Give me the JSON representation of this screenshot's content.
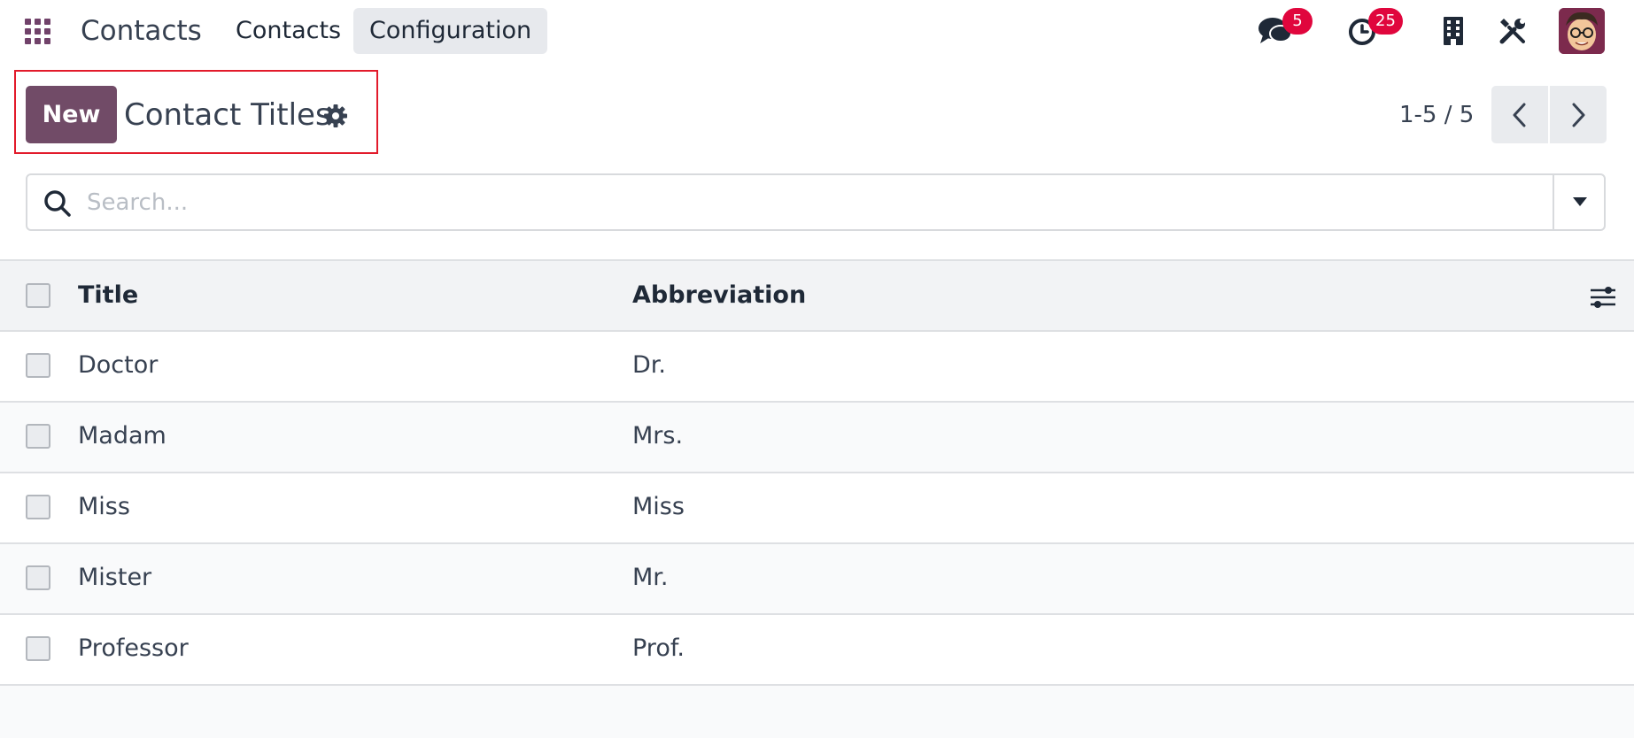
{
  "navbar": {
    "app_name": "Contacts",
    "menu": [
      {
        "label": "Contacts"
      },
      {
        "label": "Configuration",
        "active": true
      }
    ],
    "messages_badge": "5",
    "activities_badge": "25",
    "icons": [
      "apps-grid-icon",
      "chat-icon",
      "clock-icon",
      "building-icon",
      "tools-icon",
      "user-avatar"
    ]
  },
  "control_panel": {
    "new_label": "New",
    "title": "Contact Titles",
    "pager": "1-5 / 5"
  },
  "search": {
    "placeholder": "Search..."
  },
  "table": {
    "columns": [
      "Title",
      "Abbreviation"
    ],
    "rows": [
      {
        "title": "Doctor",
        "abbreviation": "Dr."
      },
      {
        "title": "Madam",
        "abbreviation": "Mrs."
      },
      {
        "title": "Miss",
        "abbreviation": "Miss"
      },
      {
        "title": "Mister",
        "abbreviation": "Mr."
      },
      {
        "title": "Professor",
        "abbreviation": "Prof."
      }
    ]
  },
  "colors": {
    "primary": "#714b67",
    "badge": "#e0063d",
    "highlight": "#e21b2b"
  }
}
